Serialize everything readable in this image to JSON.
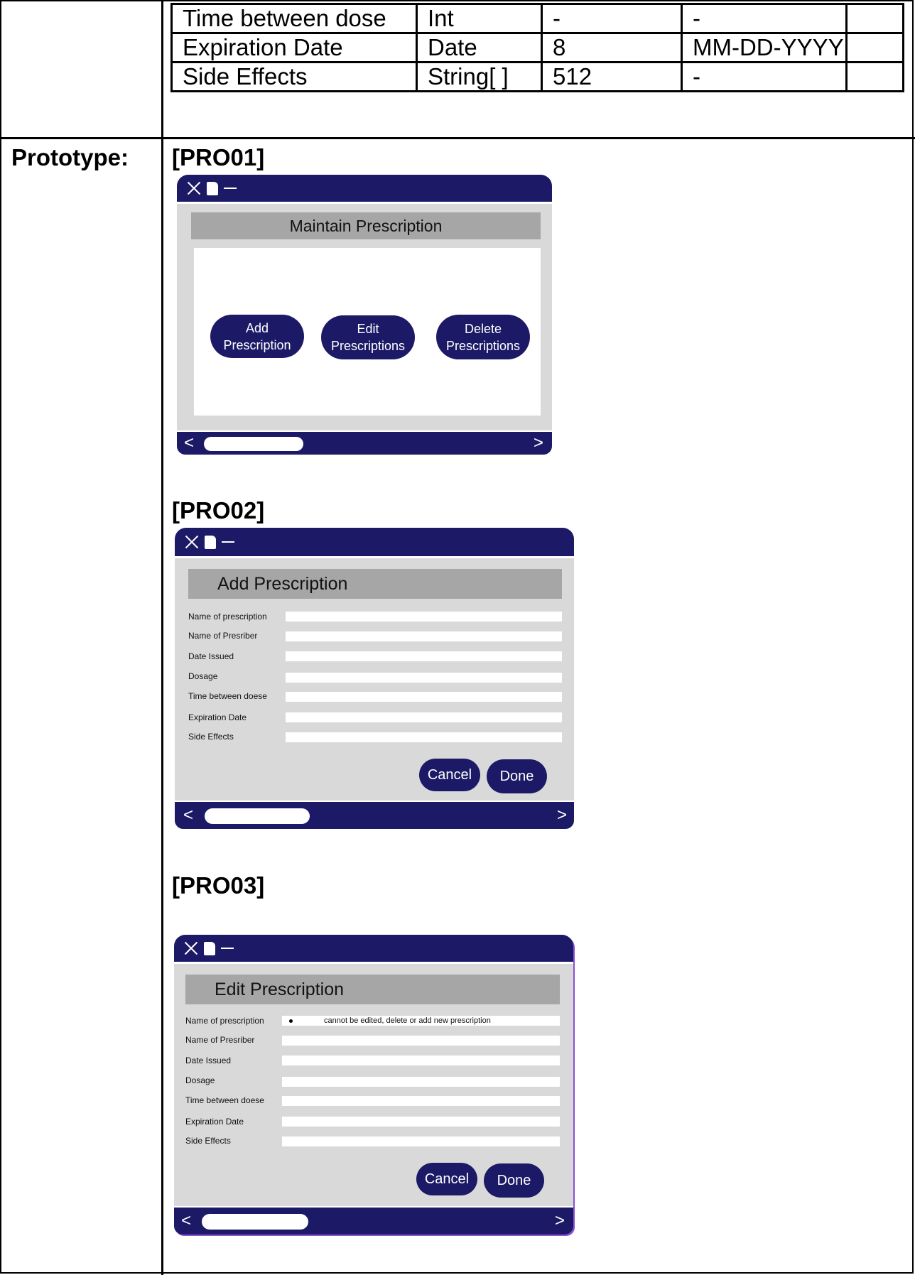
{
  "data_table": {
    "rows": [
      [
        "Time between dose",
        "Int",
        "-",
        "-",
        ""
      ],
      [
        "Expiration Date",
        "Date",
        "8",
        "MM-DD-YYYY",
        ""
      ],
      [
        "Side Effects",
        "String[ ]",
        "512",
        "-",
        ""
      ]
    ]
  },
  "prototype_label": "Prototype:",
  "pro01": {
    "id": "[PRO01]",
    "title": "Maintain Prescription",
    "buttons": {
      "add": "Add\nPrescription",
      "edit": "Edit\nPrescriptions",
      "delete": "Delete\nPrescriptions"
    },
    "nav_left": "<",
    "nav_right": ">"
  },
  "pro02": {
    "id": "[PRO02]",
    "title": "Add Prescription",
    "fields": [
      {
        "label": "Name of prescription",
        "value": ""
      },
      {
        "label": "Name of Presriber",
        "value": ""
      },
      {
        "label": "Date Issued",
        "value": ""
      },
      {
        "label": "Dosage",
        "value": ""
      },
      {
        "label": "Time between doese",
        "value": ""
      },
      {
        "label": "Expiration Date",
        "value": ""
      },
      {
        "label": "Side Effects",
        "value": ""
      }
    ],
    "cancel": "Cancel",
    "done": "Done",
    "nav_left": "<",
    "nav_right": ">"
  },
  "pro03": {
    "id": "[PRO03]",
    "title": "Edit Prescription",
    "fields": [
      {
        "label": "Name of prescription",
        "value": "cannot be edited, delete or add new prescription"
      },
      {
        "label": "Name of Presriber",
        "value": ""
      },
      {
        "label": "Date Issued",
        "value": ""
      },
      {
        "label": "Dosage",
        "value": ""
      },
      {
        "label": "Time between doese",
        "value": ""
      },
      {
        "label": "Expiration Date",
        "value": ""
      },
      {
        "label": "Side Effects",
        "value": ""
      }
    ],
    "cancel": "Cancel",
    "done": "Done",
    "nav_left": "<",
    "nav_right": ">"
  },
  "colors": {
    "window_navy": "#1c1a66",
    "header_gray": "#a6a6a6",
    "window_gray": "#d9d9d9"
  }
}
